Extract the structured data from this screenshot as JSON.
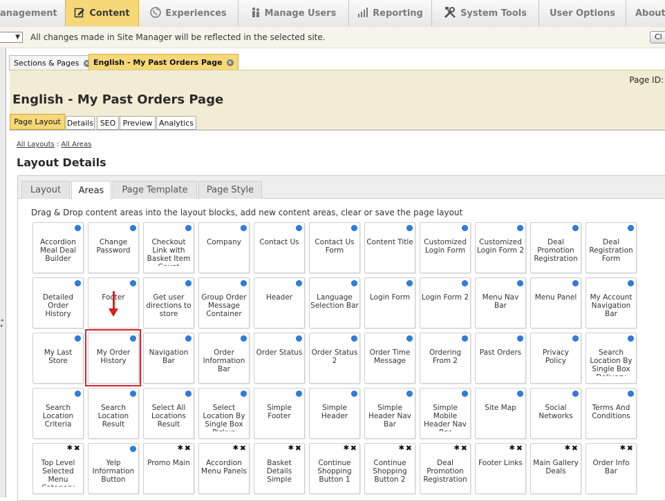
{
  "nav": {
    "items": [
      {
        "label": "anagement",
        "icon": "none"
      },
      {
        "label": "Content",
        "icon": "edit-icon",
        "active": true
      },
      {
        "label": "Experiences",
        "icon": "globe-icon"
      },
      {
        "label": "Manage Users",
        "icon": "users-icon"
      },
      {
        "label": "Reporting",
        "icon": "bar-chart-icon"
      },
      {
        "label": "System Tools",
        "icon": "tools-icon"
      },
      {
        "label": "User Options",
        "icon": "none"
      },
      {
        "label": "About",
        "icon": "none"
      }
    ]
  },
  "sitebar": {
    "message": "All changes made in Site Manager will be reflected in the selected site.",
    "button_label": "Cl",
    "select_arrow": "▼"
  },
  "tabs": [
    {
      "label": "Sections & Pages",
      "active": false
    },
    {
      "label": "English - My Past Orders Page",
      "active": true
    }
  ],
  "page": {
    "id_label": "Page ID:",
    "title": "English - My Past Orders Page",
    "tabs": [
      "Page Layout",
      "Details",
      "SEO",
      "Preview",
      "Analytics"
    ],
    "active_tab": "Page Layout"
  },
  "breadcrumb": {
    "first": "All Layouts",
    "separator": ":",
    "second": "All Areas"
  },
  "layout": {
    "title": "Layout Details",
    "tabs": [
      "Layout",
      "Areas",
      "Page Template",
      "Page Style"
    ],
    "active_tab": "Areas",
    "instructions": "Drag & Drop content areas into the layout blocks, add new content areas, clear or save the page layout"
  },
  "areas": [
    {
      "label": "Accordion Meal Deal Builder",
      "type": "system"
    },
    {
      "label": "Change Password",
      "type": "system"
    },
    {
      "label": "Checkout Link with Basket Item Count",
      "type": "system"
    },
    {
      "label": "Company",
      "type": "system"
    },
    {
      "label": "Contact Us",
      "type": "system"
    },
    {
      "label": "Contact Us Form",
      "type": "system"
    },
    {
      "label": "Content Title",
      "type": "system"
    },
    {
      "label": "Customized Login Form",
      "type": "system"
    },
    {
      "label": "Customized Login Form 2",
      "type": "system"
    },
    {
      "label": "Deal Promotion Registration",
      "type": "system"
    },
    {
      "label": "Deal Registration Form",
      "type": "system"
    },
    {
      "label": "Detailed Order History",
      "type": "system"
    },
    {
      "label": "Footer",
      "type": "system"
    },
    {
      "label": "Get user directions to store",
      "type": "system"
    },
    {
      "label": "Group Order Message Container",
      "type": "system"
    },
    {
      "label": "Header",
      "type": "system"
    },
    {
      "label": "Language Selection Bar",
      "type": "system"
    },
    {
      "label": "Login Form",
      "type": "system"
    },
    {
      "label": "Login Form 2",
      "type": "system"
    },
    {
      "label": "Menu Nav Bar",
      "type": "system"
    },
    {
      "label": "Menu Panel",
      "type": "system"
    },
    {
      "label": "My Account Navigation Bar",
      "type": "system"
    },
    {
      "label": "My Last Store",
      "type": "system"
    },
    {
      "label": "My Order History",
      "type": "system",
      "highlighted": true
    },
    {
      "label": "Navigation Bar",
      "type": "system"
    },
    {
      "label": "Order Information Bar",
      "type": "system"
    },
    {
      "label": "Order Status",
      "type": "system"
    },
    {
      "label": "Order Status 2",
      "type": "system"
    },
    {
      "label": "Order Time Message",
      "type": "system"
    },
    {
      "label": "Ordering From 2",
      "type": "system"
    },
    {
      "label": "Past Orders",
      "type": "system"
    },
    {
      "label": "Privacy Policy",
      "type": "system"
    },
    {
      "label": "Search Location By Single Box Delivery Address",
      "type": "system"
    },
    {
      "label": "Search Location Criteria",
      "type": "system"
    },
    {
      "label": "Search Location Result",
      "type": "system"
    },
    {
      "label": "Select All Locations Result",
      "type": "system"
    },
    {
      "label": "Select Location By Single Box Pickup Address",
      "type": "system"
    },
    {
      "label": "Simple Footer",
      "type": "system"
    },
    {
      "label": "Simple Header",
      "type": "system"
    },
    {
      "label": "Simple Header Nav Bar",
      "type": "system"
    },
    {
      "label": "Simple Mobile Header Nav Bar",
      "type": "system"
    },
    {
      "label": "Site Map",
      "type": "system"
    },
    {
      "label": "Social Networks",
      "type": "system"
    },
    {
      "label": "Terms And Conditions",
      "type": "system"
    },
    {
      "label": "Top Level Selected Menu Category",
      "type": "custom"
    },
    {
      "label": "Yelp Information Button",
      "type": "system"
    },
    {
      "label": "Promo Main",
      "type": "custom"
    },
    {
      "label": "Accordion Menu Panels",
      "type": "custom"
    },
    {
      "label": "Basket Details Simple",
      "type": "custom"
    },
    {
      "label": "Continue Shopping Button 1",
      "type": "custom"
    },
    {
      "label": "Continue Shopping Button 2",
      "type": "custom"
    },
    {
      "label": "Deal Promotion Registration",
      "type": "custom"
    },
    {
      "label": "Footer Links",
      "type": "custom"
    },
    {
      "label": "Main Gallery Deals",
      "type": "custom"
    },
    {
      "label": "Order Info Bar",
      "type": "custom"
    }
  ],
  "colors": {
    "accent": "#f6d878",
    "panel": "#f3ecd4",
    "gear_blue": "#2f7de1",
    "highlight_red": "#d9232b"
  }
}
